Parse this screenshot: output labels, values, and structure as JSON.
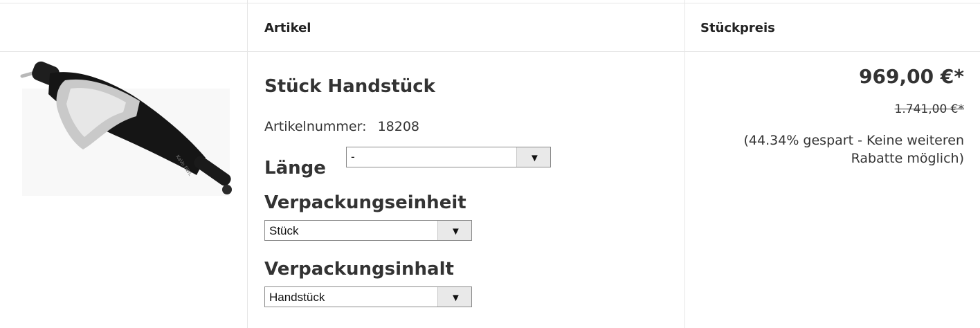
{
  "table": {
    "headers": {
      "empty": "",
      "article": "Artikel",
      "unit_price": "Stückpreis"
    }
  },
  "product": {
    "image_icon": "handpiece-image",
    "title": "Stück Handstück",
    "article_number_label": "Artikelnummer:",
    "article_number": "18208",
    "options": [
      {
        "label": "Länge",
        "selected": "-"
      },
      {
        "label": "Verpackungseinheit",
        "selected": "Stück"
      },
      {
        "label": "Verpackungsinhalt",
        "selected": "Handstück"
      }
    ],
    "dropdown_icon": "triangle-down"
  },
  "price": {
    "current": "969,00 €*",
    "old": "1.741,00 €*",
    "savings": "(44.34% gespart - Keine weiteren Rabatte möglich)"
  }
}
